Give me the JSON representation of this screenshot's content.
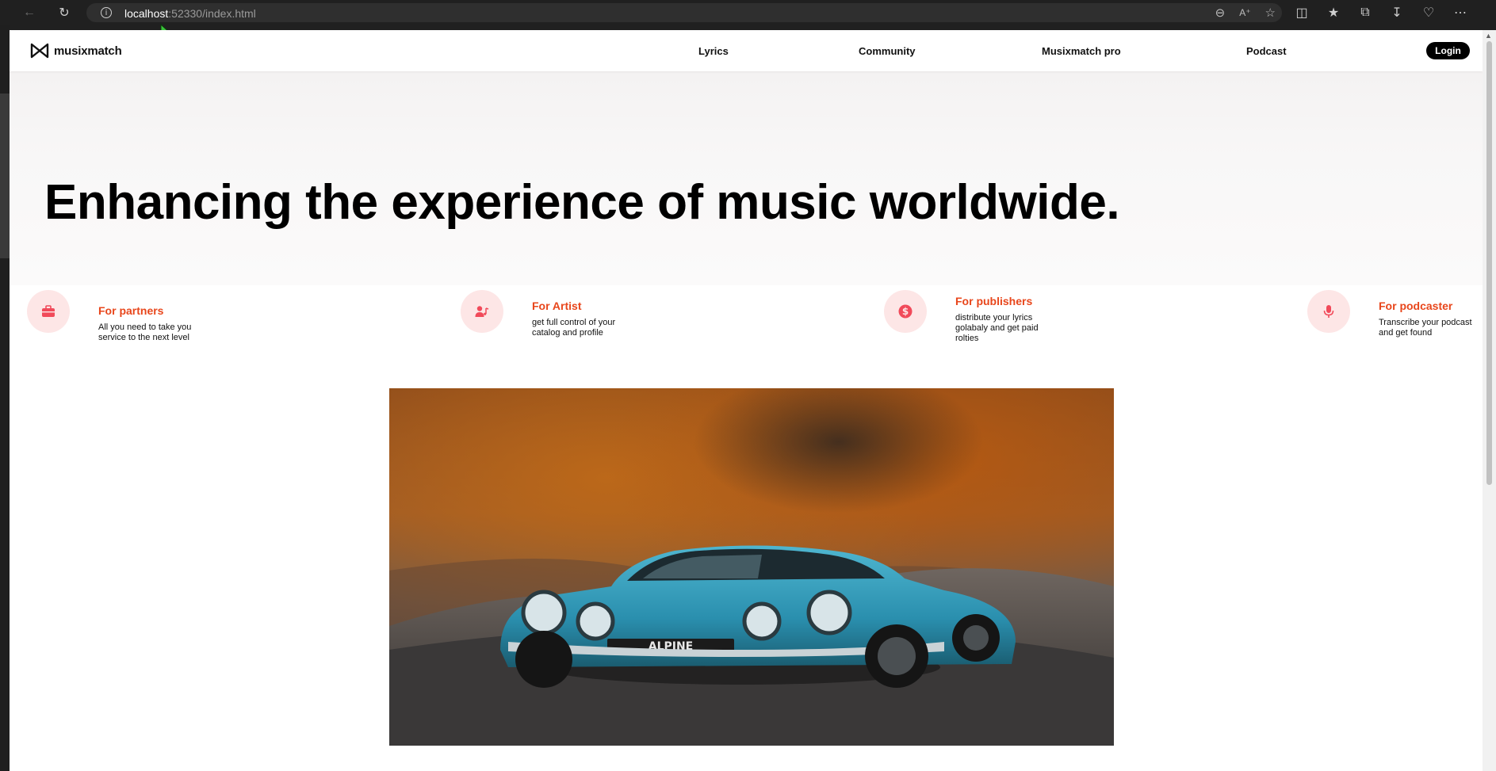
{
  "browser": {
    "url_host": "localhost",
    "url_rest": ":52330/index.html"
  },
  "nav": {
    "logo_text": "musixmatch",
    "links": [
      "Lyrics",
      "Community",
      "Musixmatch pro",
      "Podcast"
    ],
    "login_label": "Login"
  },
  "hero": {
    "title": "Enhancing the experience of music worldwide."
  },
  "features": [
    {
      "icon": "briefcase-icon",
      "title": "For partners",
      "desc": "All you need to take you service to the next level"
    },
    {
      "icon": "user-music-icon",
      "title": "For Artist",
      "desc": "get full control of your catalog and profile"
    },
    {
      "icon": "dollar-icon",
      "title": "For publishers",
      "desc": "distribute your lyrics golabaly and get paid rolties"
    },
    {
      "icon": "microphone-icon",
      "title": "For podcaster",
      "desc": "Transcribe your podcast and get found"
    }
  ],
  "colors": {
    "accent": "#e8461b",
    "icon_bg": "#fde6e6",
    "icon_fg": "#f14a5a"
  },
  "image": {
    "plate_text": "ALPINE"
  }
}
